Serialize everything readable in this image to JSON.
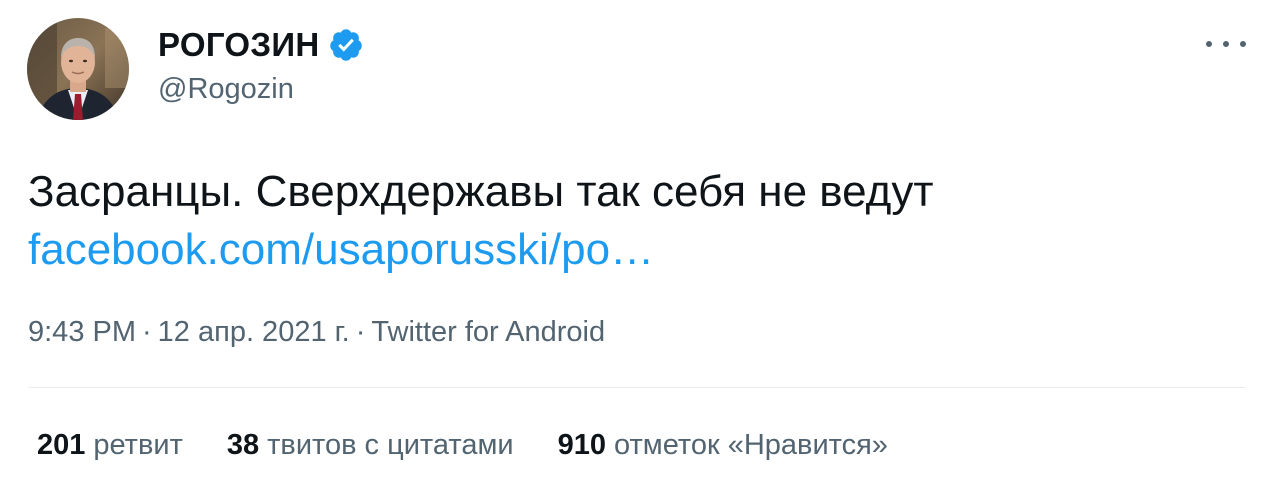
{
  "author": {
    "display_name": "РОГОЗИН",
    "handle": "@Rogozin",
    "verified": true
  },
  "tweet": {
    "text": "Засранцы. Сверхдержавы так себя не ведут",
    "link": "facebook.com/usaporusski/po…",
    "time": "9:43 PM",
    "separator": "·",
    "date": "12 апр. 2021 г.",
    "source": "Twitter for Android"
  },
  "stats": {
    "retweets_count": "201",
    "retweets_label": "ретвит",
    "quotes_count": "38",
    "quotes_label": "твитов с цитатами",
    "likes_count": "910",
    "likes_label": "отметок «Нравится»"
  },
  "colors": {
    "link": "#1d9bf0",
    "secondary_text": "#536471",
    "primary_text": "#0f1419",
    "divider": "#e6ecf0",
    "verified_badge": "#1d9bf0"
  },
  "icons": {
    "verified": "verified-badge-icon",
    "more": "more-options-icon"
  }
}
